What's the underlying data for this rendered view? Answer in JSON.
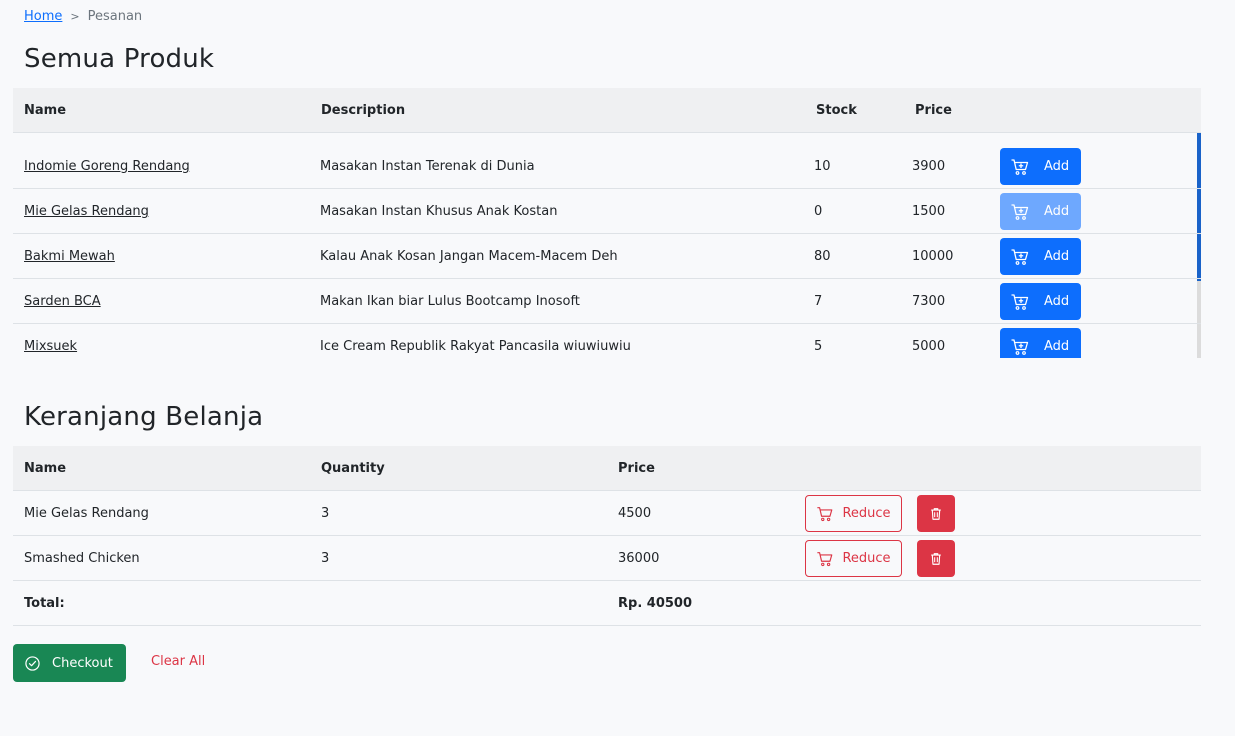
{
  "breadcrumb": {
    "home": "Home",
    "separator": ">",
    "current": "Pesanan"
  },
  "products": {
    "title": "Semua Produk",
    "headers": {
      "name": "Name",
      "description": "Description",
      "stock": "Stock",
      "price": "Price"
    },
    "add_label": "Add",
    "rows": [
      {
        "name": "Indomie Goreng Rendang",
        "description": "Masakan Instan Terenak di Dunia",
        "stock": "10",
        "price": "3900",
        "disabled": false
      },
      {
        "name": "Mie Gelas Rendang",
        "description": "Masakan Instan Khusus Anak Kostan",
        "stock": "0",
        "price": "1500",
        "disabled": true
      },
      {
        "name": "Bakmi Mewah",
        "description": "Kalau Anak Kosan Jangan Macem-Macem Deh",
        "stock": "80",
        "price": "10000",
        "disabled": false
      },
      {
        "name": "Sarden BCA",
        "description": "Makan Ikan biar Lulus Bootcamp Inosoft",
        "stock": "7",
        "price": "7300",
        "disabled": false
      },
      {
        "name": "Mixsuek",
        "description": "Ice Cream Republik Rakyat Pancasila wiuwiuwiu",
        "stock": "5",
        "price": "5000",
        "disabled": false
      }
    ]
  },
  "cart": {
    "title": "Keranjang Belanja",
    "headers": {
      "name": "Name",
      "quantity": "Quantity",
      "price": "Price"
    },
    "reduce_label": "Reduce",
    "rows": [
      {
        "name": "Mie Gelas Rendang",
        "quantity": "3",
        "price": "4500"
      },
      {
        "name": "Smashed Chicken",
        "quantity": "3",
        "price": "36000"
      }
    ],
    "total_label": "Total:",
    "total_value": "Rp. 40500"
  },
  "actions": {
    "checkout": "Checkout",
    "clear_all": "Clear All"
  },
  "colors": {
    "primary": "#0d6efd",
    "primary_disabled": "#6ea8fe",
    "danger": "#dc3545",
    "success": "#198754"
  }
}
